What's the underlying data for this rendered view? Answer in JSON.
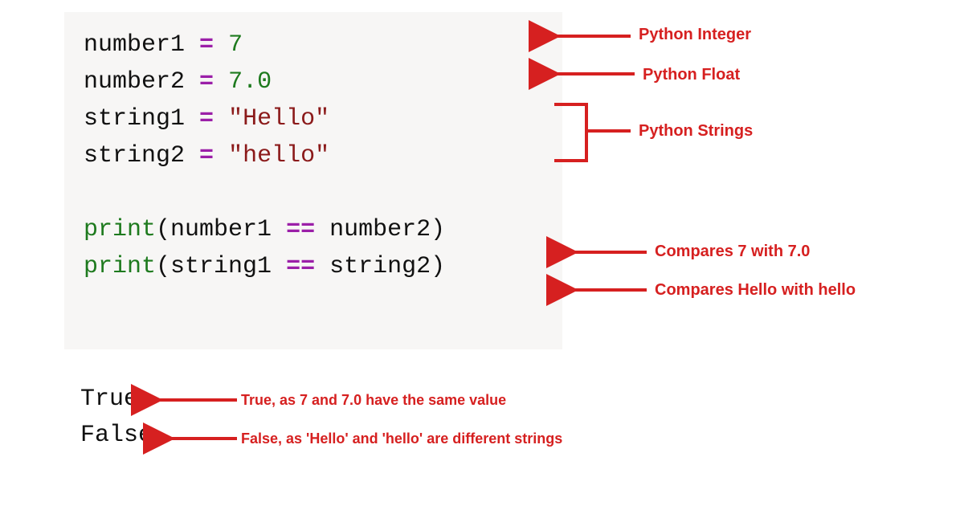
{
  "code": {
    "line1": {
      "var": "number1",
      "eq": "=",
      "val": "7"
    },
    "line2": {
      "var": "number2",
      "eq": "=",
      "val": "7.0"
    },
    "line3": {
      "var": "string1",
      "eq": "=",
      "val": "\"Hello\""
    },
    "line4": {
      "var": "string2",
      "eq": "=",
      "val": "\"hello\""
    },
    "line6": {
      "fn": "print",
      "lp": "(",
      "a": "number1",
      "op": "==",
      "b": "number2",
      "rp": ")"
    },
    "line7": {
      "fn": "print",
      "lp": "(",
      "a": "string1",
      "op": "==",
      "b": "string2",
      "rp": ")"
    }
  },
  "output": {
    "true": "True",
    "false": "False"
  },
  "annotations": {
    "int": "Python Integer",
    "float": "Python Float",
    "strings": "Python Strings",
    "cmp1": "Compares 7 with 7.0",
    "cmp2": "Compares Hello with hello",
    "exp1": "True, as 7 and 7.0 have the same value",
    "exp2": "False, as 'Hello' and 'hello' are different strings"
  },
  "colors": {
    "annotation": "#d62020",
    "operator": "#9b1fa8",
    "number": "#1e7a1e",
    "string": "#8b1a1a",
    "codebg": "#f7f6f5"
  }
}
